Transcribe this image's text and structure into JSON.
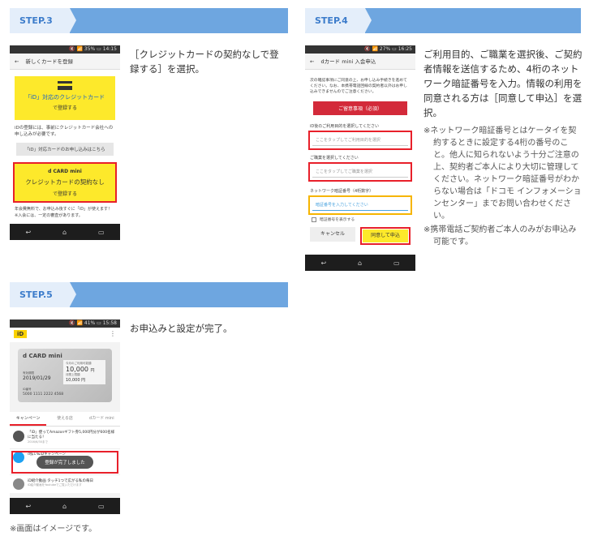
{
  "steps": {
    "s3": {
      "label": "STEP.3",
      "description": "［クレジットカードの契約なしで登録する］を選択。",
      "phone": {
        "status": "🔇 📶 35% ▭ 14:15",
        "back": "←",
        "title": "新しくカードを登録",
        "card_line1": "「iD」対応のクレジットカード",
        "card_line2": "で登録する",
        "info_text": "iDの登録には、事前にクレジットカード会社への申し込みが必要です。",
        "apply_link": "「iD」対応カードのお申し込みはこちら",
        "dcard_logo": "d CARD mini",
        "option_line1": "クレジットカードの契約なし",
        "option_line2": "で登録する",
        "footer_text": "年会費無料で、お申込み後すぐに「iD」が使えます！※入会には、一定の審査があります。"
      }
    },
    "s4": {
      "label": "STEP.4",
      "description": "ご利用目的、ご職業を選択後、ご契約者情報を送信するため、4桁のネットワーク暗証番号を入力。情報の利用を同意される方は［同意して申込］を選択。",
      "notes": [
        "※ネットワーク暗証番号とはケータイを契約するときに設定する4桁の番号のこと。他人に知られないよう十分ご注意の上、契約者ご本人により大切に管理してください。ネットワーク暗証番号がわからない場合は「ドコモ インフォメーションセンター」までお問い合わせください。",
        "※携帯電話ご契約者ご本人のみがお申込み可能です。"
      ],
      "phone": {
        "status": "🔇 📶 27% ▭ 16:25",
        "back": "←",
        "title": "dカード mini 入会申込",
        "intro": "次の確認事項にご同意の上、お申し込み手続きを進めてください。なお、本携帯電話回線の契約者以外はお申し込みできませんのでご注意ください。",
        "terms_button": "ご留意事項（必須）",
        "purpose_label": "iD後のご利用目的を選択してください",
        "purpose_placeholder": "ここをタップしてご利用目的を選択",
        "job_label": "ご職業を選択してください",
        "job_placeholder": "ここをタップしてご職業を選択",
        "pin_label": "ネットワーク暗証番号（4桁数字）",
        "pin_placeholder": "暗証番号を入力してください",
        "show_pin": "暗証番号を表示する",
        "cancel": "キャンセル",
        "agree": "同意して申込"
      }
    },
    "s5": {
      "label": "STEP.5",
      "description": "お申込みと設定が完了。",
      "phone": {
        "status": "🔇 📶 41% ▭ 15:58",
        "app_logo": "iD",
        "menu": "⋮",
        "card_brand": "d CARD mini",
        "balance_caption": "今月のご利用可能額",
        "balance": "10,000",
        "balance_unit": "円",
        "limit_caption": "月間上限額",
        "limit": "10,000",
        "limit_unit": "円",
        "date_caption": "有効期限",
        "date": "2019/01/29",
        "card_number_caption": "iD番号",
        "card_number": "5000 1111 2222 4568",
        "tabs": [
          "キャンペーン",
          "使える店",
          "dカード mini"
        ],
        "news1_title": "「iD」使ってAmazonギフト券5,000円分が600名様に当たる！",
        "news1_date": "2016/6/30まで",
        "news2_title": "d払い&iDキャンペーン",
        "toast": "登録が完了しました",
        "news3_title": "iD紹介動画 タッチ1つで広がる私の毎日",
        "news3_sub": "iD紹介動画をYoutubeでご覧いただけます"
      }
    }
  },
  "nav": {
    "back": "↩",
    "home": "⌂",
    "recent": "▭"
  },
  "footnote": "※画面はイメージです。"
}
